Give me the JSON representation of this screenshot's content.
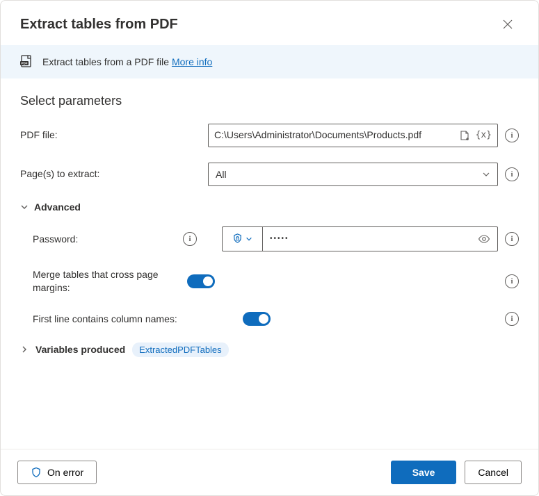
{
  "header": {
    "title": "Extract tables from PDF"
  },
  "banner": {
    "text": "Extract tables from a PDF file ",
    "link": "More info"
  },
  "section_title": "Select parameters",
  "params": {
    "pdf_file_label": "PDF file:",
    "pdf_file_value": "C:\\Users\\Administrator\\Documents\\Products.pdf",
    "pages_label": "Page(s) to extract:",
    "pages_value": "All"
  },
  "advanced": {
    "title": "Advanced",
    "password_label": "Password:",
    "password_value": "•••••",
    "merge_label": "Merge tables that cross page margins:",
    "merge_value": true,
    "first_line_label": "First line contains column names:",
    "first_line_value": true
  },
  "variables": {
    "title": "Variables produced",
    "chip": "ExtractedPDFTables"
  },
  "footer": {
    "on_error": "On error",
    "save": "Save",
    "cancel": "Cancel"
  }
}
